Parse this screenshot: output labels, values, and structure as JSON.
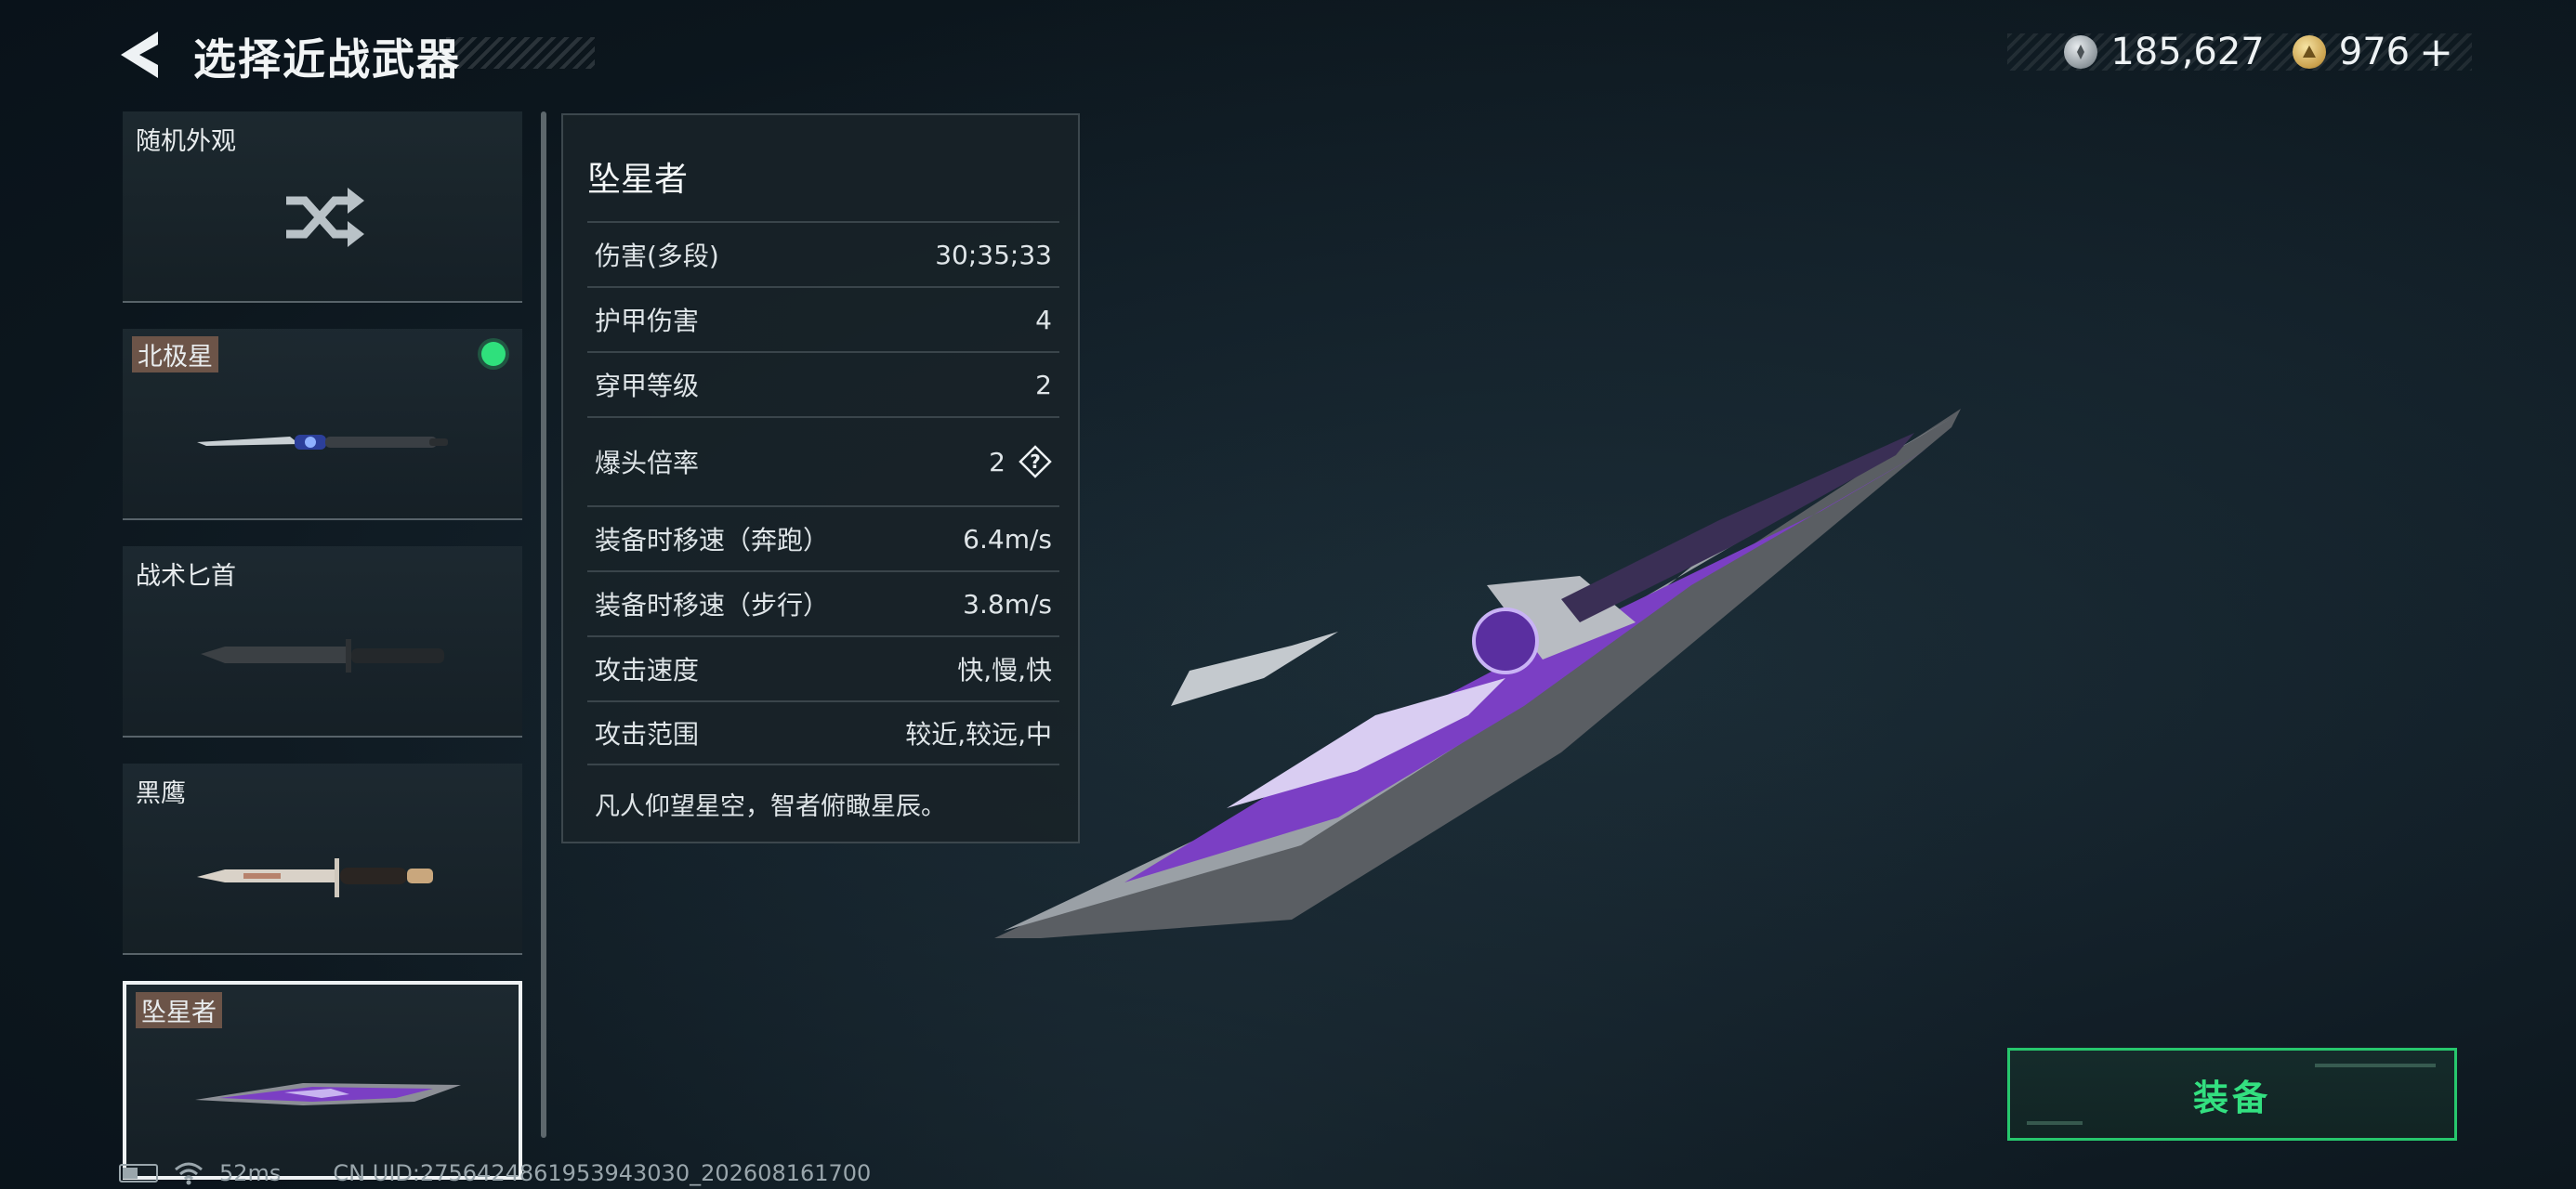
{
  "header": {
    "title": "选择近战武器"
  },
  "currency": {
    "silver_value": "185,627",
    "gold_value": "976",
    "add_label": "+"
  },
  "weapon_list": [
    {
      "name": "随机外观",
      "type": "random",
      "equipped": false,
      "selected": false
    },
    {
      "name": "北极星",
      "type": "knife",
      "equipped": true,
      "selected": false
    },
    {
      "name": "战术匕首",
      "type": "knife",
      "equipped": false,
      "selected": false
    },
    {
      "name": "黑鹰",
      "type": "knife",
      "equipped": false,
      "selected": false
    },
    {
      "name": "坠星者",
      "type": "knife",
      "equipped": false,
      "selected": true
    }
  ],
  "stats": {
    "title": "坠星者",
    "rows": [
      {
        "label": "伤害(多段)",
        "value": "30;35;33"
      },
      {
        "label": "护甲伤害",
        "value": "4"
      },
      {
        "label": "穿甲等级",
        "value": "2"
      },
      {
        "label": "爆头倍率",
        "value": "2"
      },
      {
        "label": "装备时移速（奔跑）",
        "value": "6.4m/s"
      },
      {
        "label": "装备时移速（步行）",
        "value": "3.8m/s"
      },
      {
        "label": "攻击速度",
        "value": "快,慢,快"
      },
      {
        "label": "攻击范围",
        "value": "较近,较远,中"
      }
    ],
    "help_glyph": "?",
    "description": "凡人仰望星空，智者俯瞰星辰。"
  },
  "equip_button": {
    "label": "装备"
  },
  "status_bar": {
    "ping": "52ms",
    "uid": "CN UID:2756424861953943030_202608161700"
  },
  "colors": {
    "accent_green": "#33e080",
    "equipped_dot": "#2fe07c",
    "tag_bg": "#6c5448",
    "blade_purple": "#7b3fc4"
  },
  "icons": [
    "back-arrow-icon",
    "silver-coin-icon",
    "gold-coin-icon",
    "shuffle-icon",
    "help-icon",
    "battery-icon",
    "wifi-icon"
  ]
}
